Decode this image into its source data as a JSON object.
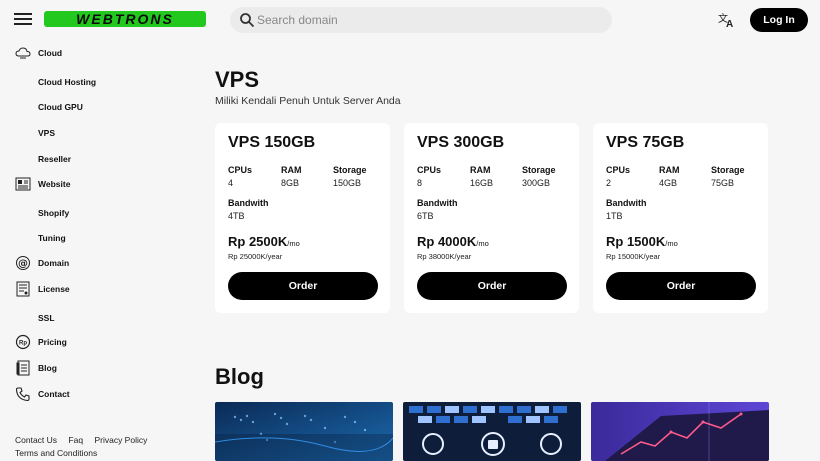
{
  "header": {
    "logo_text": "WEBTRONS",
    "search_placeholder": "Search domain",
    "login_label": "Log In",
    "icons": [
      "menu-icon",
      "search-icon",
      "translate-icon"
    ]
  },
  "sidebar": {
    "items": [
      {
        "label": "Cloud",
        "icon": "cloud-icon"
      },
      {
        "label": "Cloud Hosting"
      },
      {
        "label": "Cloud GPU"
      },
      {
        "label": "VPS"
      },
      {
        "label": "Reseller"
      },
      {
        "label": "Website",
        "icon": "website-icon"
      },
      {
        "label": "Shopify"
      },
      {
        "label": "Tuning"
      },
      {
        "label": "Domain",
        "icon": "at-icon"
      },
      {
        "label": "License",
        "icon": "license-icon"
      },
      {
        "label": "SSL"
      },
      {
        "label": "Pricing",
        "icon": "rupiah-icon"
      },
      {
        "label": "Blog",
        "icon": "blog-icon"
      },
      {
        "label": "Contact",
        "icon": "phone-icon"
      }
    ],
    "footer": {
      "contact": "Contact Us",
      "faq": "Faq",
      "privacy": "Privacy Policy",
      "terms": "Terms and Conditions"
    }
  },
  "main": {
    "title": "VPS",
    "subtitle": "Miliki Kendali Penuh Untuk Server Anda",
    "spec_labels": {
      "cpus": "CPUs",
      "ram": "RAM",
      "storage": "Storage",
      "bandwidth": "Bandwith"
    },
    "plans": [
      {
        "name": "VPS 150GB",
        "cpus": "4",
        "ram": "8GB",
        "storage": "150GB",
        "bandwidth": "4TB",
        "price": "Rp 2500K",
        "per": "/mo",
        "yearly": "Rp 25000K/year",
        "order": "Order"
      },
      {
        "name": "VPS 300GB",
        "cpus": "8",
        "ram": "16GB",
        "storage": "300GB",
        "bandwidth": "6TB",
        "price": "Rp 4000K",
        "per": "/mo",
        "yearly": "Rp 38000K/year",
        "order": "Order"
      },
      {
        "name": "VPS 75GB",
        "cpus": "2",
        "ram": "4GB",
        "storage": "75GB",
        "bandwidth": "1TB",
        "price": "Rp 1500K",
        "per": "/mo",
        "yearly": "Rp 15000K/year",
        "order": "Order"
      }
    ],
    "blog_title": "Blog"
  },
  "colors": {
    "accent": "#000000",
    "logo_green": "#22c81e",
    "background": "#f6f6f6",
    "card": "#ffffff"
  }
}
